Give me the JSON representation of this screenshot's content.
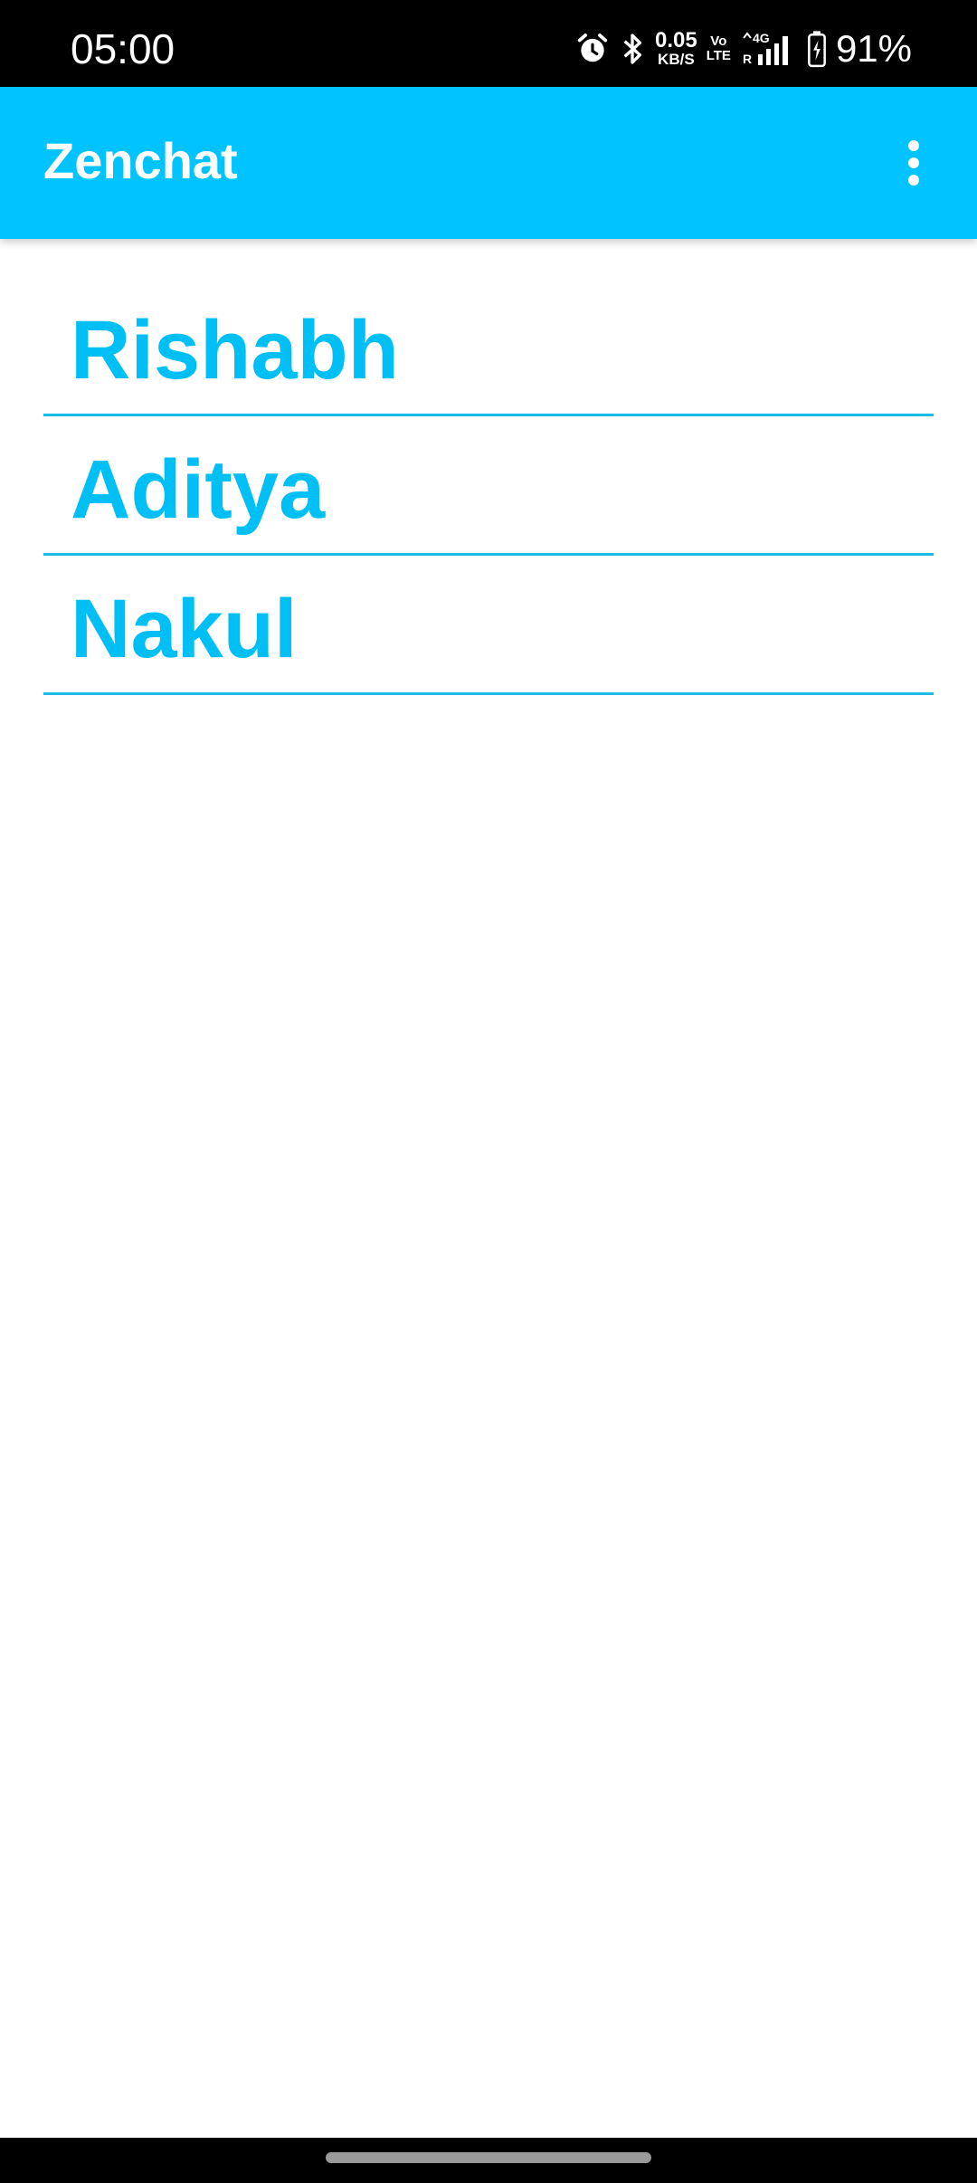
{
  "status_bar": {
    "time": "05:00",
    "net_speed_value": "0.05",
    "net_speed_unit": "KB/S",
    "volte_top": "Vo",
    "volte_bottom": "LTE",
    "network_type": "4G",
    "roaming": "R",
    "battery_percent": "91%",
    "icons": [
      "alarm-icon",
      "bluetooth-icon",
      "signal-icon",
      "battery-charging-icon"
    ]
  },
  "app_bar": {
    "title": "Zenchat",
    "background_color": "#00C3FF",
    "overflow_icon": "more-vert-icon"
  },
  "chat_list": {
    "items": [
      {
        "name": "Rishabh"
      },
      {
        "name": "Aditya"
      },
      {
        "name": "Nakul"
      }
    ],
    "text_color": "#00BFF5",
    "divider_color": "#1EBBEA"
  }
}
